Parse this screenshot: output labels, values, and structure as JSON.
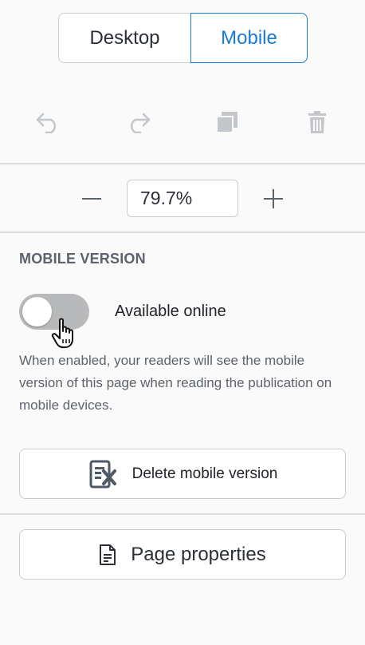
{
  "view_switch": {
    "desktop_label": "Desktop",
    "mobile_label": "Mobile",
    "active": "Mobile"
  },
  "toolbar": {
    "undo_icon": "undo-icon",
    "redo_icon": "redo-icon",
    "duplicate_icon": "duplicate-icon",
    "delete_icon": "trash-icon"
  },
  "zoom": {
    "value": "79.7%",
    "minus_icon": "minus-icon",
    "plus_icon": "plus-icon"
  },
  "mobile_version": {
    "title": "MOBILE VERSION",
    "toggle_label": "Available online",
    "toggle_on": false,
    "description": "When enabled, your readers will see the mobile version of this page when reading the publication on mobile devices.",
    "delete_button_label": "Delete mobile version"
  },
  "page_properties": {
    "button_label": "Page properties"
  },
  "colors": {
    "accent": "#1a7ad8",
    "toggle_off": "#b7b9bb",
    "icon_disabled": "#c3c6ca"
  }
}
